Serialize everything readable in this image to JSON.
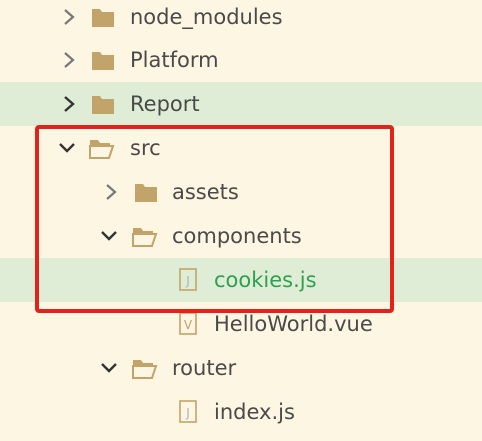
{
  "explorer": {
    "items": [
      {
        "label": "node_modules",
        "type": "folder",
        "state": "collapsed"
      },
      {
        "label": "Platform",
        "type": "folder",
        "state": "collapsed"
      },
      {
        "label": "Report",
        "type": "folder",
        "state": "collapsed",
        "selected": true
      },
      {
        "label": "src",
        "type": "folder",
        "state": "expanded"
      },
      {
        "label": "assets",
        "type": "folder",
        "state": "collapsed"
      },
      {
        "label": "components",
        "type": "folder",
        "state": "expanded"
      },
      {
        "label": "cookies.js",
        "type": "file",
        "file_icon": "J",
        "active": true
      },
      {
        "label": "HelloWorld.vue",
        "type": "file",
        "file_icon": "V"
      },
      {
        "label": "router",
        "type": "folder",
        "state": "expanded"
      },
      {
        "label": "index.js",
        "type": "file",
        "file_icon": "J"
      }
    ]
  },
  "colors": {
    "background": "#FDF6E3",
    "selected_row": "#E0EDD6",
    "folder": "#C2A36A",
    "text": "#4A4A4A",
    "active_text": "#2EA04F",
    "highlight_border": "#E2231A"
  }
}
